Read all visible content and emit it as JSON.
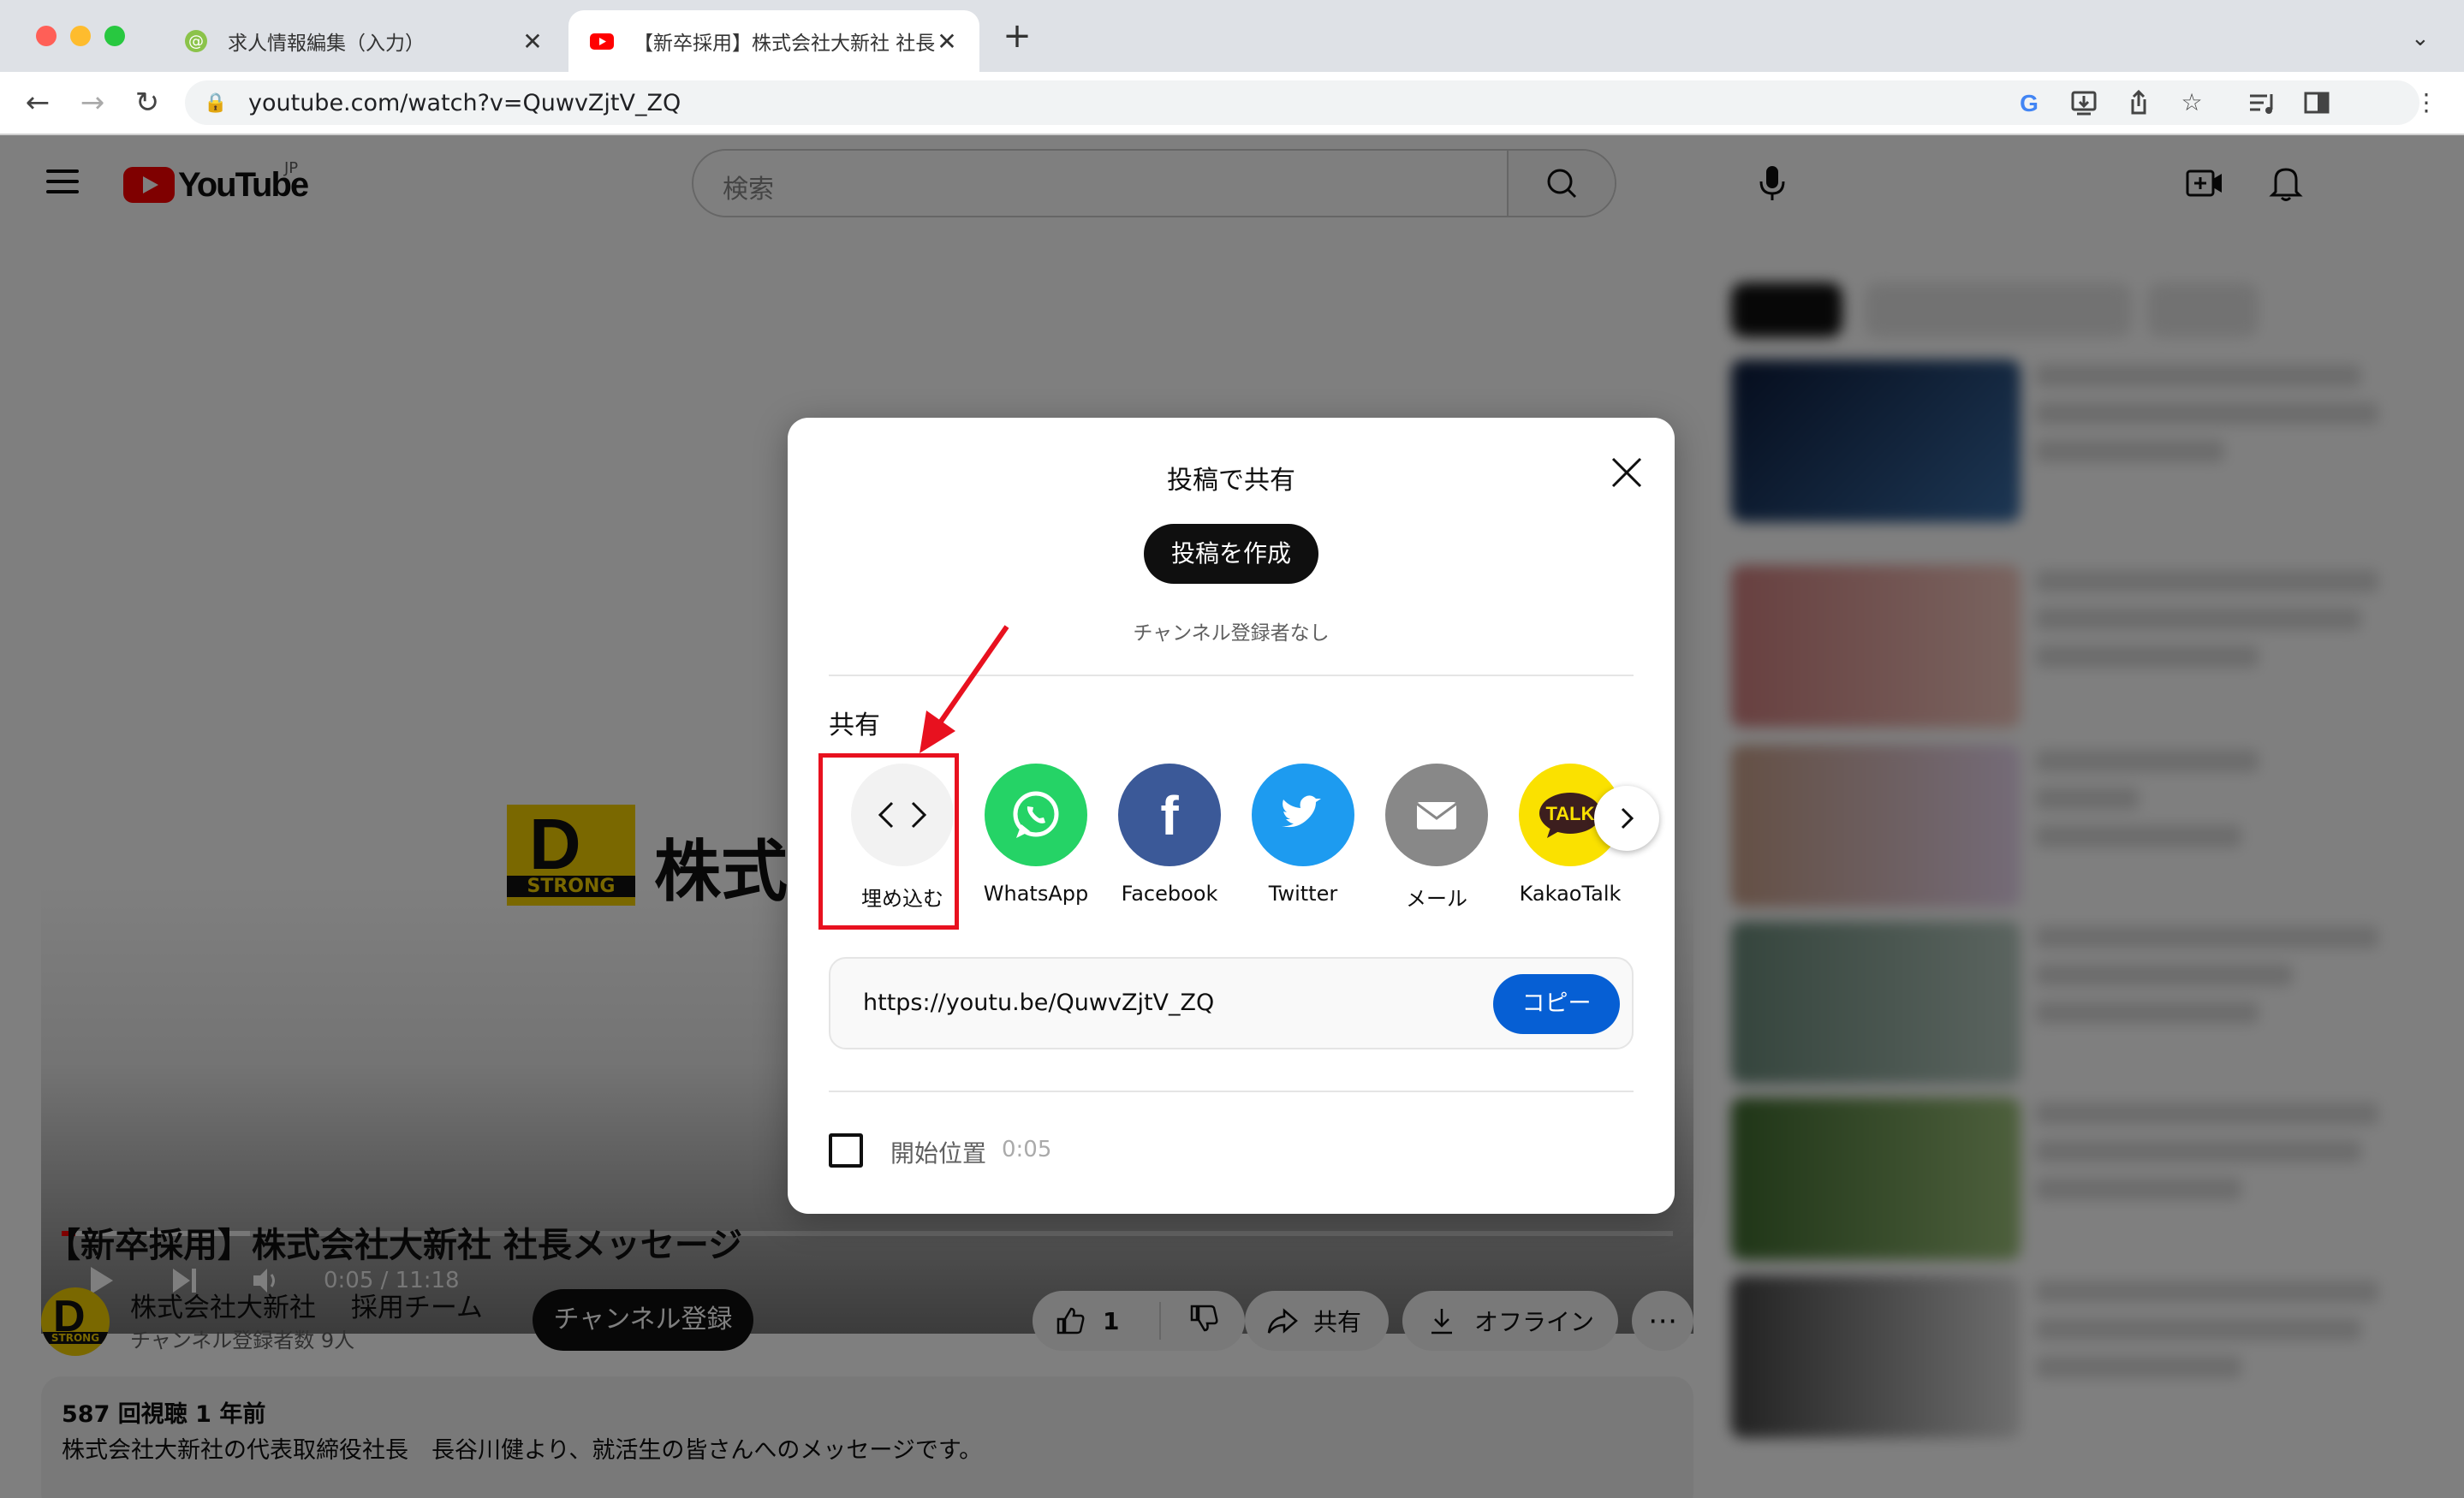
{
  "browser": {
    "tabs": [
      {
        "title": "求人情報編集（入力）",
        "active": false
      },
      {
        "title": "【新卒採用】株式会社大新社 社長メッセージ - YouTube",
        "active": true
      }
    ],
    "url": "youtube.com/watch?v=QuwvZjtV_ZQ"
  },
  "youtube": {
    "logo_text": "YouTube",
    "region": "JP",
    "search_placeholder": "検索",
    "video": {
      "logo_letter": "D",
      "logo_word": "STRONG",
      "frame_text": "株式会社",
      "time": "0:05 / 11:18",
      "progress_fraction": 0.008,
      "title": "【新卒採用】株式会社大新社 社長メッセージ",
      "views_line": "587 回視聴  1 年前",
      "description": "株式会社大新社の代表取締役社長　長谷川健より、就活生の皆さんへのメッセージです。"
    },
    "channel": {
      "name": "株式会社大新社　 採用チーム",
      "subscribers": "チャンネル登録者数 9人",
      "subscribe_label": "チャンネル登録"
    },
    "actions": {
      "likes": "1",
      "share": "共有",
      "offline": "オフライン"
    }
  },
  "dialog": {
    "title": "投稿で共有",
    "create_post": "投稿を作成",
    "no_subscribers": "チャンネル登録者なし",
    "share_heading": "共有",
    "targets": [
      {
        "label": "埋め込む",
        "color": "#f2f2f2"
      },
      {
        "label": "WhatsApp",
        "color": "#25d366"
      },
      {
        "label": "Facebook",
        "color": "#3b5998"
      },
      {
        "label": "Twitter",
        "color": "#1d9bf0"
      },
      {
        "label": "メール",
        "color": "#888888"
      },
      {
        "label": "KakaoTalk",
        "color": "#fae100"
      }
    ],
    "kakao_badge": "TALK",
    "share_url": "https://youtu.be/QuwvZjtV_ZQ",
    "copy_label": "コピー",
    "start_label": "開始位置",
    "start_time": "0:05"
  }
}
